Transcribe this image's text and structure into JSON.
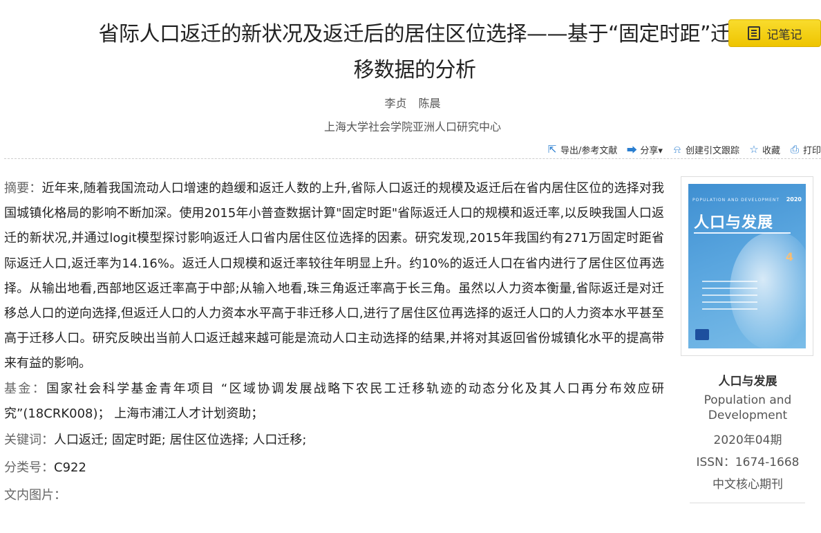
{
  "article": {
    "title": "省际人口返迁的新状况及返迁后的居住区位选择——基于“固定时距”迁移数据的分析",
    "authors": [
      "李贞",
      "陈晨"
    ],
    "organization": "上海大学社会学院亚洲人口研究中心"
  },
  "note_button": {
    "label": "记笔记",
    "icon": "notebook-icon"
  },
  "toolbar": [
    {
      "label": "导出/参考文献",
      "icon": "export-icon"
    },
    {
      "label": "分享▾",
      "icon": "share-icon"
    },
    {
      "label": "创建引文跟踪",
      "icon": "bell-icon"
    },
    {
      "label": "收藏",
      "icon": "star-icon"
    },
    {
      "label": "打印",
      "icon": "print-icon"
    }
  ],
  "abstract": {
    "label": "摘要：",
    "text": "近年来,随着我国流动人口增速的趋缓和返迁人数的上升,省际人口返迁的规模及返迁后在省内居住区位的选择对我国城镇化格局的影响不断加深。使用2015年小普查数据计算\"固定时距\"省际返迁人口的规模和返迁率,以反映我国人口返迁的新状况,并通过logit模型探讨影响返迁人口省内居住区位选择的因素。研究发现,2015年我国约有271万固定时距省际返迁人口,返迁率为14.16%。返迁人口规模和返迁率较往年明显上升。约10%的返迁人口在省内进行了居住区位再选择。从输出地看,西部地区返迁率高于中部;从输入地看,珠三角返迁率高于长三角。虽然以人力资本衡量,省际返迁是对迁移总人口的逆向选择,但返迁人口的人力资本水平高于非迁移人口,进行了居住区位再选择的返迁人口的人力资本水平甚至高于迁移人口。研究反映出当前人口返迁越来越可能是流动人口主动选择的结果,并将对其返回省份城镇化水平的提高带来有益的影响。"
  },
  "fund": {
    "label": "基金：",
    "text": "国家社会科学基金青年项目 “区域协调发展战略下农民工迁移轨迹的动态分化及其人口再分布效应研究”(18CRK008)； 上海市浦江人才计划资助；"
  },
  "keywords": {
    "label": "关键词：",
    "items": [
      "人口返迁;",
      "固定时距;",
      "居住区位选择;",
      "人口迁移;"
    ]
  },
  "classification": {
    "label": "分类号：",
    "value": "C922"
  },
  "figures": {
    "label": "文内图片："
  },
  "journal": {
    "name": "人口与发展",
    "english_name": "Population and Development",
    "issue": "2020年04期",
    "issn": "ISSN：1674-1668",
    "core": "中文核心期刊",
    "cover": {
      "en_title": "POPULATION AND DEVELOPMENT",
      "year": "2020",
      "cn_title": "人口与发展",
      "number": "4"
    }
  }
}
